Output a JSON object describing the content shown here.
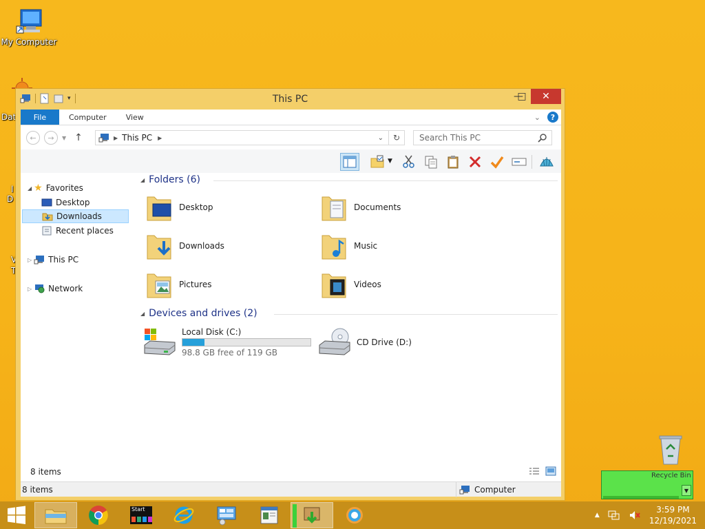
{
  "desktop": {
    "my_computer_label": "My Computer",
    "recycle_label": "Recycle Bin",
    "partial_labels": [
      "Dat",
      "l",
      "D",
      "V",
      "T"
    ]
  },
  "window": {
    "title": "This PC",
    "ribbon_tabs": [
      "File",
      "Computer",
      "View"
    ],
    "address_path": "This PC",
    "search_placeholder": "Search This PC",
    "nav": {
      "favorites": "Favorites",
      "desktop": "Desktop",
      "downloads": "Downloads",
      "recent": "Recent places",
      "this_pc": "This PC",
      "network": "Network"
    },
    "folders_header": "Folders (6)",
    "folders": [
      "Desktop",
      "Documents",
      "Downloads",
      "Music",
      "Pictures",
      "Videos"
    ],
    "devices_header": "Devices and drives (2)",
    "drives": {
      "c_label": "Local Disk (C:)",
      "c_free": "98.8 GB free of 119 GB",
      "c_used_fraction": 0.17,
      "d_label": "CD Drive (D:)"
    },
    "items_count_inner": "8 items",
    "status_items": "8 items",
    "status_location": "Computer"
  },
  "taskbar": {
    "start_tile": "Start",
    "time": "3:59 PM",
    "date": "12/19/2021"
  },
  "colors": {
    "accent": "#1979ca",
    "desktop_bg": "#f6b319",
    "close_red": "#c7382e",
    "drive_fill": "#26a0da"
  }
}
